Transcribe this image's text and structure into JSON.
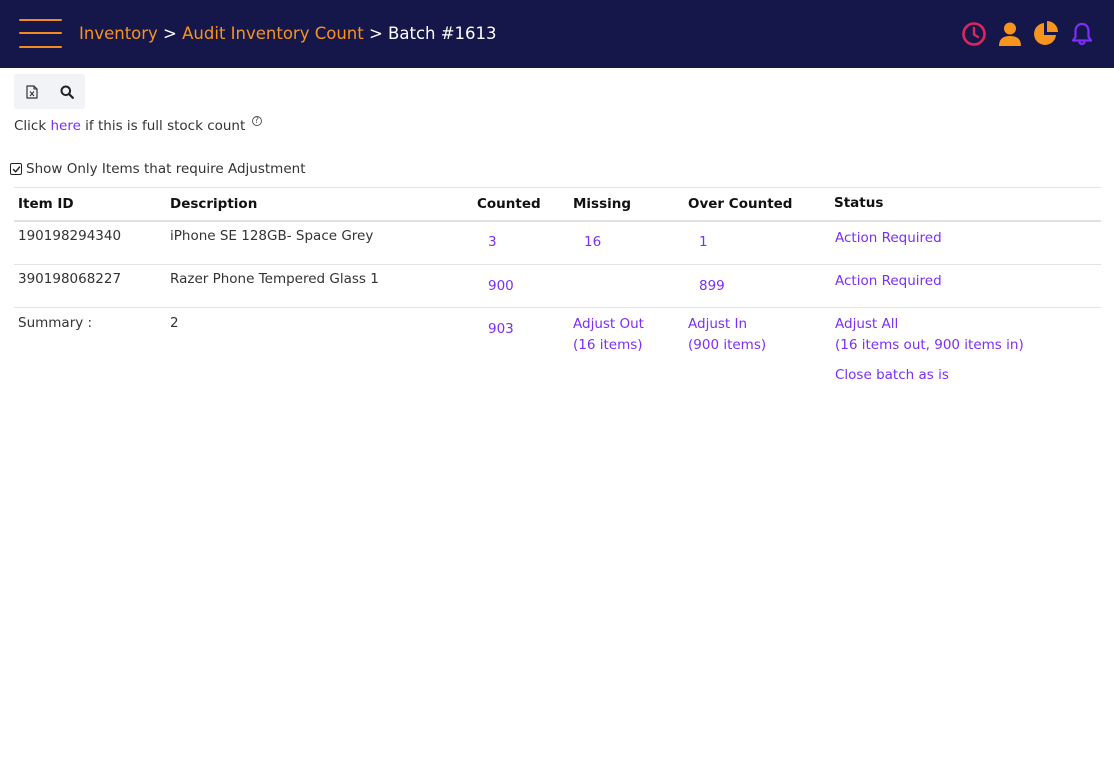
{
  "header": {
    "breadcrumb": {
      "inventory": "Inventory",
      "sep1": " > ",
      "audit": "Audit Inventory Count",
      "sep2": " > ",
      "current": "Batch #1613"
    },
    "icons": [
      "clock-icon",
      "user-icon",
      "pie-chart-icon",
      "bell-icon"
    ],
    "colors": {
      "bar": "#15174a",
      "accent": "#f7941e",
      "clock": "#e0245e",
      "bell": "#7b2ff7"
    }
  },
  "toolbar": {
    "icons": [
      "excel-export-icon",
      "search-icon"
    ]
  },
  "fullcount": {
    "prefix": "Click ",
    "link": "here",
    "suffix": " if this is full stock count",
    "help": "?"
  },
  "filter": {
    "label": "Show Only Items that require Adjustment",
    "checked": true
  },
  "table": {
    "headers": {
      "item_id": "Item ID",
      "description": "Description",
      "counted": "Counted",
      "missing": "Missing",
      "over_counted": "Over Counted",
      "status": "Status"
    },
    "rows": [
      {
        "item_id": "190198294340",
        "description": "iPhone SE 128GB- Space Grey",
        "counted": "3",
        "missing": "16",
        "over_counted": "1",
        "status": "Action Required"
      },
      {
        "item_id": "390198068227",
        "description": "Razer Phone Tempered Glass 1",
        "counted": "900",
        "missing": "",
        "over_counted": "899",
        "status": "Action Required"
      }
    ],
    "summary": {
      "label": "Summary :",
      "count": "2",
      "counted": "903",
      "adjust_out": "Adjust Out",
      "adjust_out_detail": "(16 items)",
      "adjust_in": "Adjust In",
      "adjust_in_detail": "(900 items)",
      "adjust_all": "Adjust All",
      "adjust_all_detail": "(16 items out, 900 items in)",
      "close_batch": "Close batch as is"
    }
  }
}
